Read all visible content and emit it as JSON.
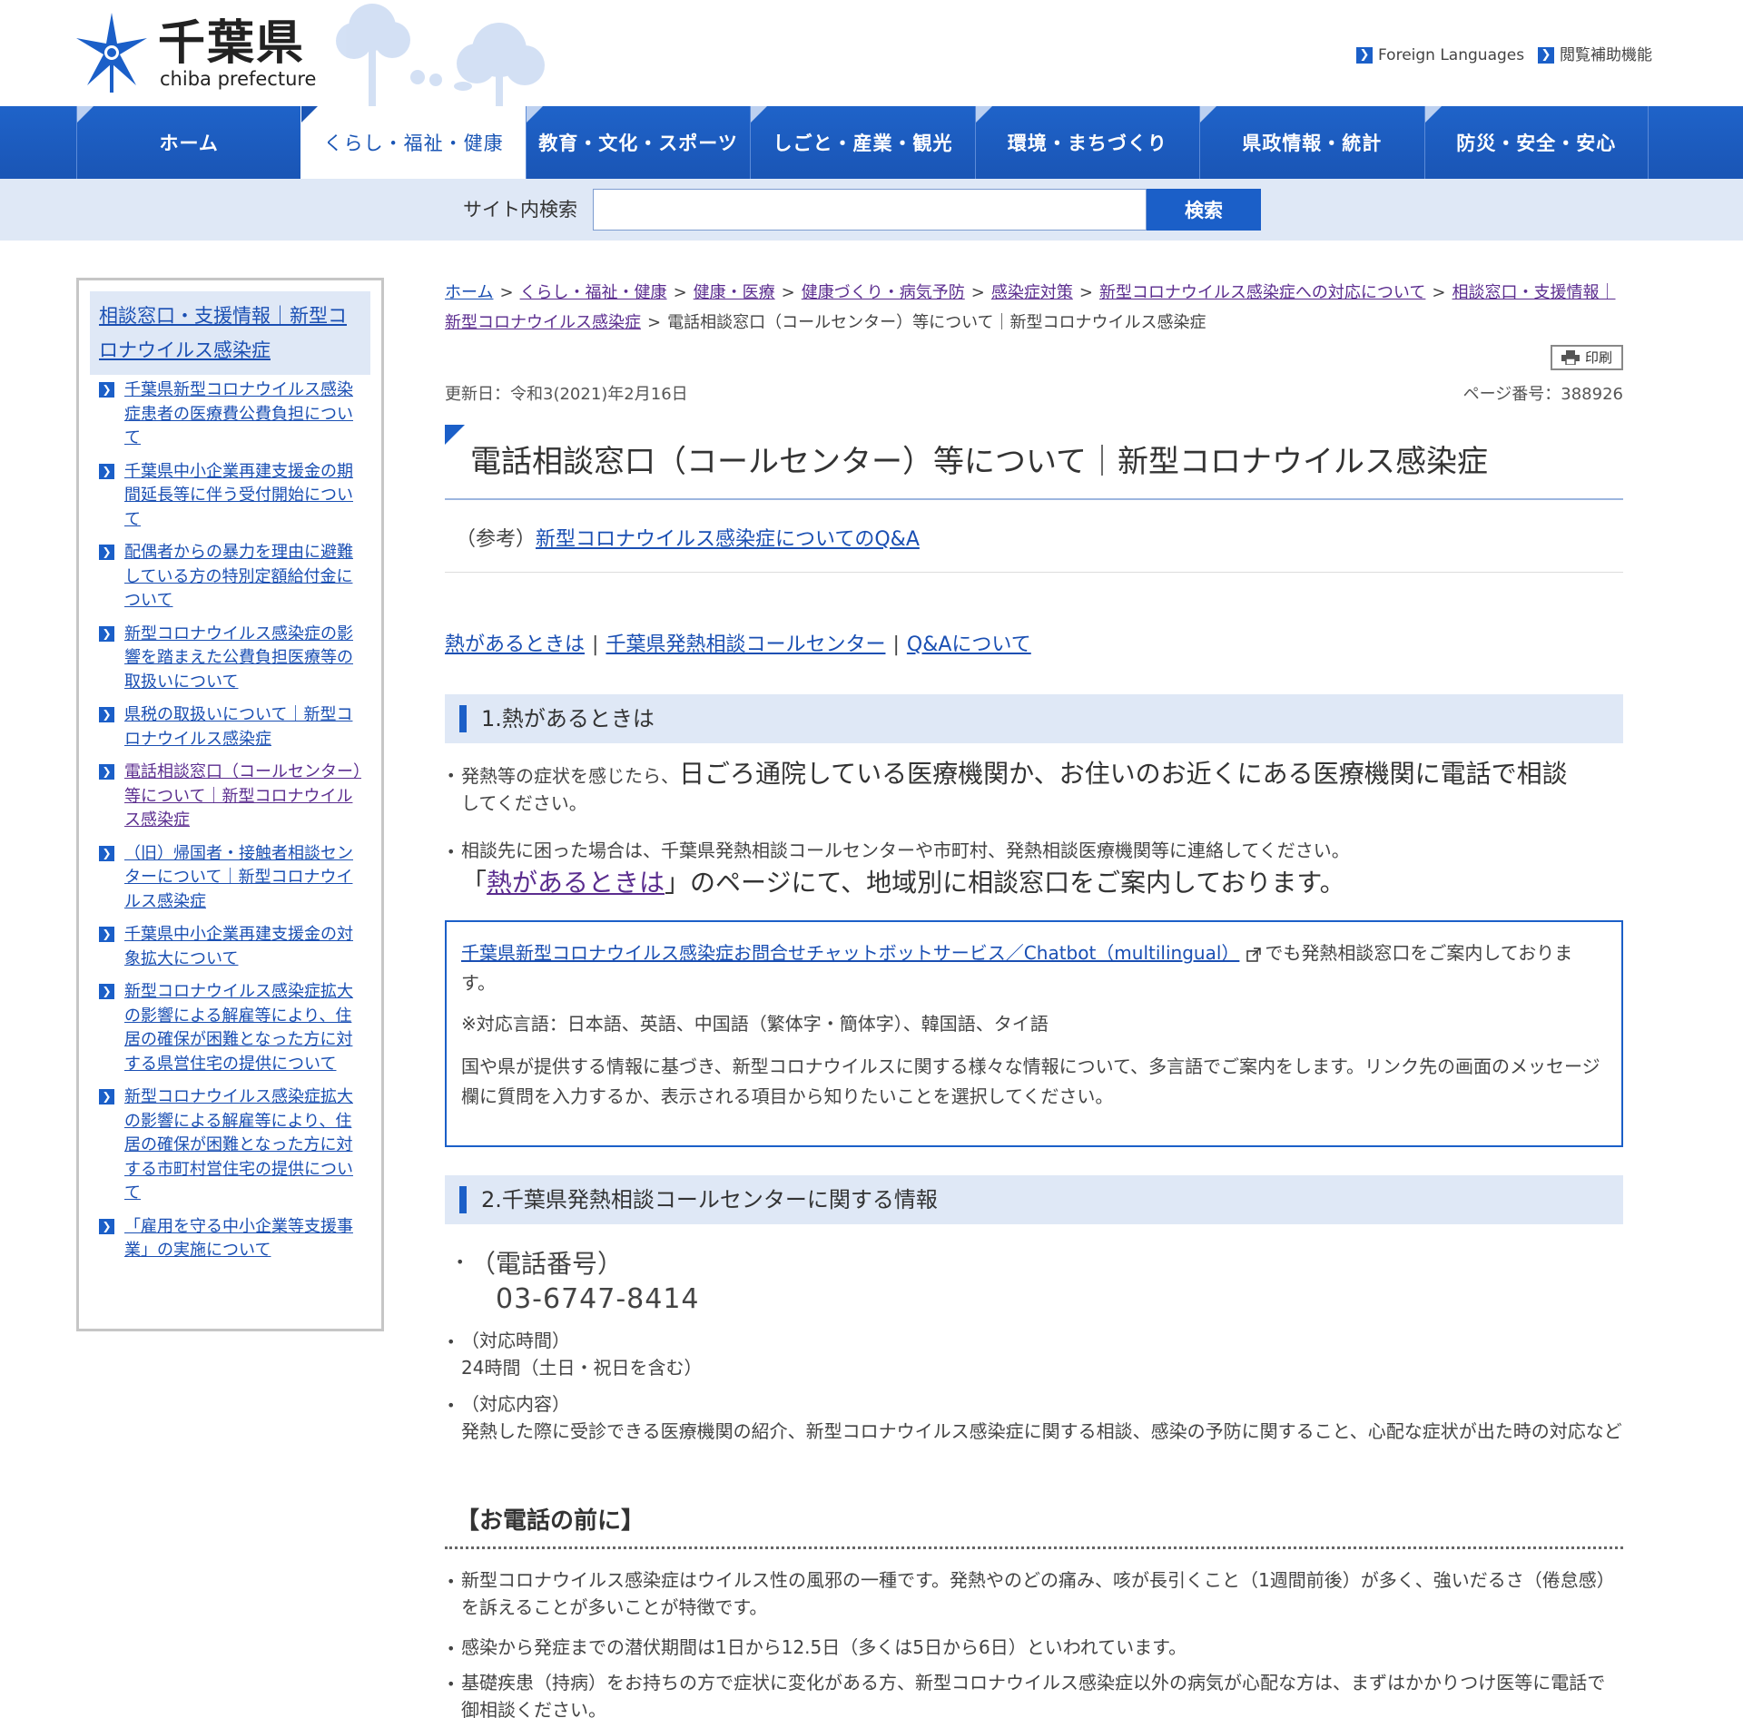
{
  "header": {
    "logo_name": "千葉県",
    "logo_sub": "chiba prefecture",
    "foreign_languages": "Foreign Languages",
    "accessibility": "閲覧補助機能"
  },
  "nav": [
    {
      "label": "ホーム"
    },
    {
      "label": "くらし・福祉・健康"
    },
    {
      "label": "教育・文化・スポーツ"
    },
    {
      "label": "しごと・産業・観光"
    },
    {
      "label": "環境・まちづくり"
    },
    {
      "label": "県政情報・統計"
    },
    {
      "label": "防災・安全・安心"
    }
  ],
  "search": {
    "label": "サイト内検索",
    "placeholder": "",
    "button": "検索"
  },
  "sidebar": {
    "title": "相談窓口・支援情報｜新型コロナウイルス感染症",
    "items": [
      {
        "label": "千葉県新型コロナウイルス感染症患者の医療費公費負担について"
      },
      {
        "label": "千葉県中小企業再建支援金の期間延長等に伴う受付開始について"
      },
      {
        "label": "配偶者からの暴力を理由に避難している方の特別定額給付金について"
      },
      {
        "label": "新型コロナウイルス感染症の影響を踏まえた公費負担医療等の取扱いについて"
      },
      {
        "label": "県税の取扱いについて｜新型コロナウイルス感染症"
      },
      {
        "label": "電話相談窓口（コールセンター）等について｜新型コロナウイルス感染症"
      },
      {
        "label": "（旧）帰国者・接触者相談センターについて｜新型コロナウイルス感染症"
      },
      {
        "label": "千葉県中小企業再建支援金の対象拡大について"
      },
      {
        "label": "新型コロナウイルス感染症拡大の影響による解雇等により、住居の確保が困難となった方に対する県営住宅の提供について"
      },
      {
        "label": "新型コロナウイルス感染症拡大の影響による解雇等により、住居の確保が困難となった方に対する市町村営住宅の提供について"
      },
      {
        "label": "「雇用を守る中小企業等支援事業」の実施について"
      }
    ]
  },
  "breadcrumb": {
    "items": [
      "ホーム",
      "くらし・福祉・健康",
      "健康・医療",
      "健康づくり・病気予防",
      "感染症対策",
      "新型コロナウイルス感染症への対応について",
      "相談窓口・支援情報｜新型コロナウイルス感染症"
    ],
    "current": "電話相談窓口（コールセンター）等について｜新型コロナウイルス感染症"
  },
  "page": {
    "print_label": "印刷",
    "updated": "更新日：令和3(2021)年2月16日",
    "page_number": "ページ番号：388926",
    "title": "電話相談窓口（コールセンター）等について｜新型コロナウイルス感染症",
    "ref_prefix": "（参考）",
    "ref_link": "新型コロナウイルス感染症についてのQ&A",
    "anchors": [
      "熱があるときは",
      "千葉県発熱相談コールセンター",
      "Q&Aについて"
    ]
  },
  "section1": {
    "heading": "1.熱があるときは",
    "b1_pre": "発熱等の症状を感じたら、",
    "b1_big": "日ごろ通院している医療機関か、お住いのお近くにある医療機関に電話で相談",
    "b1_post": "してください。",
    "b2_text": "相談先に困った場合は、千葉県発熱相談コールセンターや市町村、発熱相談医療機関等に連絡してください。",
    "b2_big_pre": "「",
    "b2_big_link": "熱があるときは",
    "b2_big_post": "」のページにて、地域別に相談窓口をご案内しております。",
    "chatbot_link": "千葉県新型コロナウイルス感染症お問合せチャットボットサービス／Chatbot（multilingual）",
    "chatbot_tail": "でも発熱相談窓口をご案内しております。",
    "languages": "※対応言語：日本語、英語、中国語（繁体字・簡体字）、韓国語、タイ語",
    "description": "国や県が提供する情報に基づき、新型コロナウイルスに関する様々な情報について、多言語でご案内をします。リンク先の画面のメッセージ欄に質問を入力するか、表示される項目から知りたいことを選択してください。"
  },
  "section2": {
    "heading": "2.千葉県発熱相談コールセンターに関する情報",
    "phone_label": "（電話番号）",
    "phone": "03-6747-8414",
    "hours_label": "（対応時間）",
    "hours": "24時間（土日・祝日を含む）",
    "content_label": "（対応内容）",
    "content": "発熱した際に受診できる医療機関の紹介、新型コロナウイルス感染症に関する相談、感染の予防に関すること、心配な症状が出た時の対応など"
  },
  "before_call": {
    "heading": "【お電話の前に】",
    "items": [
      "新型コロナウイルス感染症はウイルス性の風邪の一種です。発熱やのどの痛み、咳が長引くこと（1週間前後）が多く、強いだるさ（倦怠感）を訴えることが多いことが特徴です。",
      "感染から発症までの潜伏期間は1日から12.5日（多くは5日から6日）といわれています。",
      "基礎疾患（持病）をお持ちの方で症状に変化がある方、新型コロナウイルス感染症以外の病気が心配な方は、まずはかかりつけ医等に電話で御相談ください。"
    ]
  },
  "colors": {
    "brand_blue": "#1b5fc8",
    "light_blue_bg": "#dfe8f6",
    "link": "#1a4fb3",
    "visited": "#5b2d8f"
  }
}
